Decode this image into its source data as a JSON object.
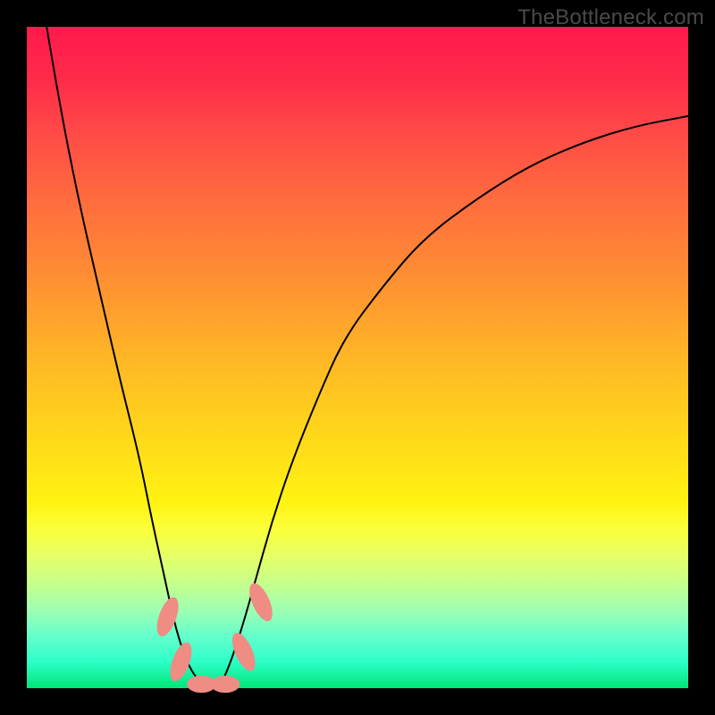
{
  "watermark": "TheBottleneck.com",
  "chart_data": {
    "type": "line",
    "title": "",
    "xlabel": "",
    "ylabel": "",
    "xlim": [
      0,
      100
    ],
    "ylim": [
      0,
      100
    ],
    "grid": false,
    "series": [
      {
        "name": "curve",
        "x": [
          3,
          5,
          8,
          11,
          14,
          17,
          19,
          21,
          22.5,
          24.5,
          27,
          29,
          30.5,
          32.5,
          34.5,
          37,
          40,
          44,
          48,
          54,
          60,
          68,
          76,
          84,
          92,
          100
        ],
        "values": [
          100,
          88,
          73,
          60,
          47,
          35,
          25,
          16,
          9,
          3,
          0,
          0,
          3,
          9,
          16,
          25,
          34,
          44,
          53,
          61,
          68,
          74,
          79,
          82.5,
          85,
          86.5
        ]
      }
    ],
    "markers": [
      {
        "name": "cap-left-upper",
        "cx": 21.3,
        "cy": 10.8,
        "rx": 1.3,
        "ry": 3.1,
        "rot": 20
      },
      {
        "name": "cap-left-lower",
        "cx": 23.3,
        "cy": 4.0,
        "rx": 1.3,
        "ry": 3.1,
        "rot": 20
      },
      {
        "name": "cap-bottom-left",
        "cx": 26.4,
        "cy": 0.6,
        "rx": 2.2,
        "ry": 1.3,
        "rot": 0
      },
      {
        "name": "cap-bottom-right",
        "cx": 30.0,
        "cy": 0.6,
        "rx": 2.2,
        "ry": 1.3,
        "rot": 0
      },
      {
        "name": "cap-right-lower",
        "cx": 32.8,
        "cy": 5.5,
        "rx": 1.3,
        "ry": 3.1,
        "rot": -24
      },
      {
        "name": "cap-right-upper",
        "cx": 35.4,
        "cy": 13.0,
        "rx": 1.3,
        "ry": 3.1,
        "rot": -24
      }
    ],
    "marker_color": "#ef8c84",
    "curve_color": "#000000"
  }
}
